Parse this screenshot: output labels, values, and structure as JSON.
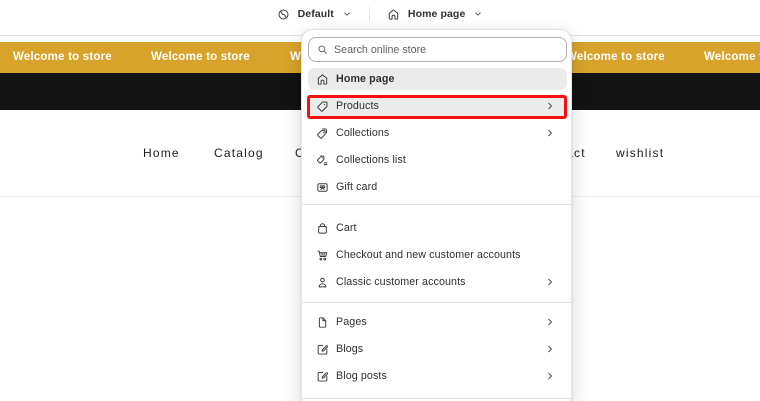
{
  "topbar": {
    "theme_selector": {
      "label": "Default",
      "icon": "theme-globe-icon"
    },
    "page_selector": {
      "label": "Home page",
      "icon": "home-icon"
    }
  },
  "announcement": {
    "text": "Welcome to store",
    "background_color": "#d7a32b",
    "text_color": "#ffffff"
  },
  "store_nav": {
    "items": [
      {
        "label": "Home"
      },
      {
        "label": "Catalog"
      },
      {
        "label": "Collections"
      },
      {
        "label": "Contact"
      },
      {
        "label": "wishlist"
      }
    ]
  },
  "popover": {
    "search": {
      "placeholder": "Search online store",
      "icon": "search-icon"
    },
    "groups": [
      {
        "items": [
          {
            "label": "Home page",
            "icon": "home-icon",
            "selected": true,
            "chevron": false
          },
          {
            "label": "Products",
            "icon": "tag-icon",
            "selected": false,
            "chevron": true,
            "annotated": true
          },
          {
            "label": "Collections",
            "icon": "collections-icon",
            "selected": false,
            "chevron": true
          },
          {
            "label": "Collections list",
            "icon": "collections-list-icon",
            "selected": false,
            "chevron": false
          },
          {
            "label": "Gift card",
            "icon": "gift-card-icon",
            "selected": false,
            "chevron": false
          }
        ]
      },
      {
        "items": [
          {
            "label": "Cart",
            "icon": "bag-icon",
            "selected": false,
            "chevron": false
          },
          {
            "label": "Checkout and new customer accounts",
            "icon": "cart-icon",
            "selected": false,
            "chevron": false
          },
          {
            "label": "Classic customer accounts",
            "icon": "person-icon",
            "selected": false,
            "chevron": true
          }
        ]
      },
      {
        "items": [
          {
            "label": "Pages",
            "icon": "page-icon",
            "selected": false,
            "chevron": true
          },
          {
            "label": "Blogs",
            "icon": "compose-icon",
            "selected": false,
            "chevron": true
          },
          {
            "label": "Blog posts",
            "icon": "compose-icon",
            "selected": false,
            "chevron": true
          }
        ]
      }
    ],
    "annotation_color": "#f80f0f"
  }
}
